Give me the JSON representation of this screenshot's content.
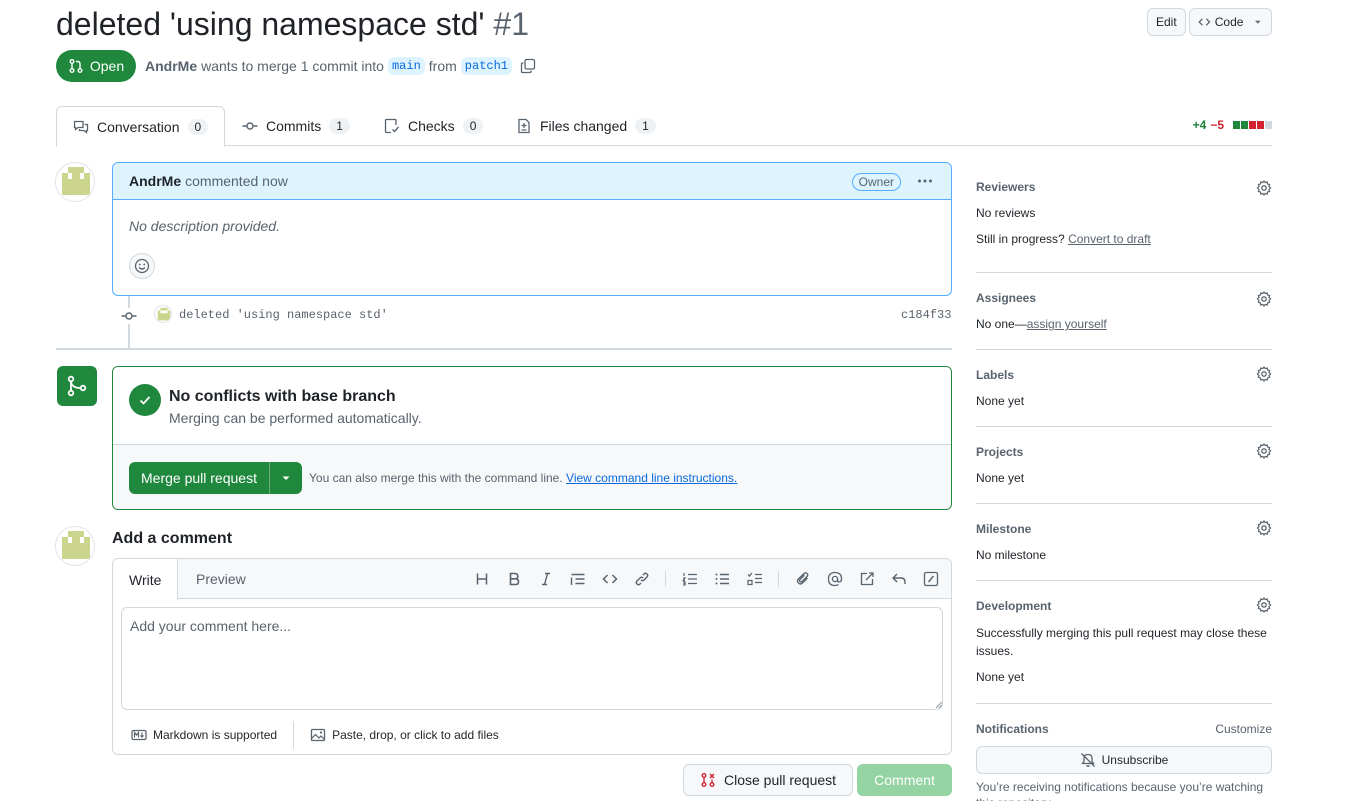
{
  "header": {
    "title": "deleted 'using namespace std'",
    "number": "#1",
    "edit_label": "Edit",
    "code_label": "Code",
    "state_label": "Open",
    "author": "AndrMe",
    "merge_text": "wants to merge 1 commit into",
    "base_branch": "main",
    "from_text": "from",
    "head_branch": "patch1"
  },
  "tabs": [
    {
      "label": "Conversation",
      "count": "0"
    },
    {
      "label": "Commits",
      "count": "1"
    },
    {
      "label": "Checks",
      "count": "0"
    },
    {
      "label": "Files changed",
      "count": "1"
    }
  ],
  "diffstat": {
    "additions": "+4",
    "deletions": "−5",
    "colors": [
      "#1f883d",
      "#1f883d",
      "#d1242f",
      "#d1242f",
      "#d1d9e0"
    ]
  },
  "comment": {
    "author": "AndrMe",
    "action": "commented now",
    "badge": "Owner",
    "body": "No description provided."
  },
  "commit": {
    "message": "deleted 'using namespace std'",
    "sha": "c184f33"
  },
  "merge": {
    "title": "No conflicts with base branch",
    "subtitle": "Merging can be performed automatically.",
    "button": "Merge pull request",
    "hint": "You can also merge this with the command line.",
    "hint_link": "View command line instructions."
  },
  "add_comment": {
    "title": "Add a comment",
    "tab_write": "Write",
    "tab_preview": "Preview",
    "placeholder": "Add your comment here...",
    "markdown_note": "Markdown is supported",
    "attach_note": "Paste, drop, or click to add files",
    "close_button": "Close pull request",
    "comment_button": "Comment"
  },
  "sidebar": {
    "reviewers": {
      "title": "Reviewers",
      "value": "No reviews",
      "progress_q": "Still in progress?",
      "progress_link": "Convert to draft"
    },
    "assignees": {
      "title": "Assignees",
      "value": "No one—",
      "link": "assign yourself"
    },
    "labels": {
      "title": "Labels",
      "value": "None yet"
    },
    "projects": {
      "title": "Projects",
      "value": "None yet"
    },
    "milestone": {
      "title": "Milestone",
      "value": "No milestone"
    },
    "development": {
      "title": "Development",
      "note": "Successfully merging this pull request may close these issues.",
      "value": "None yet"
    },
    "notifications": {
      "title": "Notifications",
      "customize": "Customize",
      "button": "Unsubscribe",
      "note": "You’re receiving notifications because you’re watching this repository."
    }
  },
  "colors": {
    "green": "#1f883d",
    "blue": "#0969da",
    "accent_bg": "#ddf4ff"
  }
}
